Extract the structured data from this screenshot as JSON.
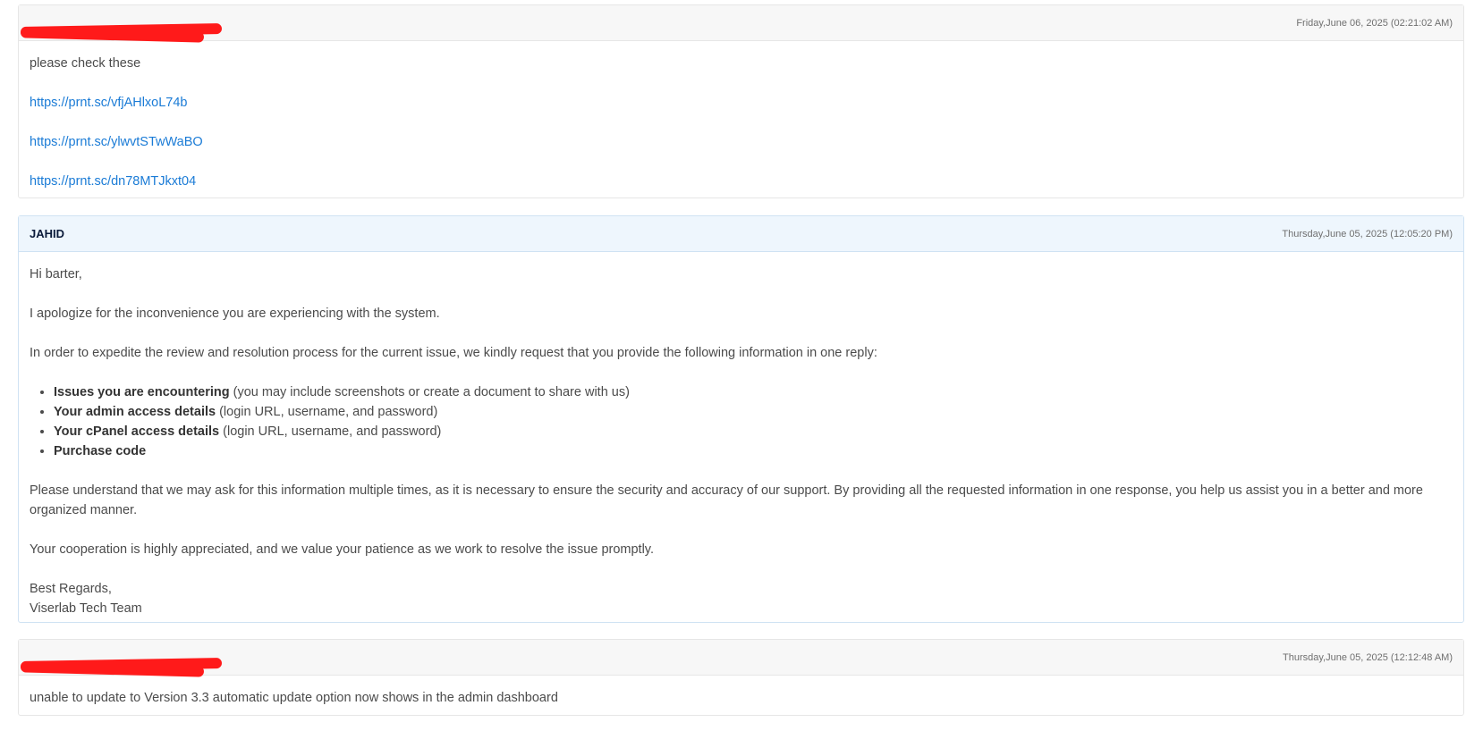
{
  "messages": [
    {
      "author": "",
      "email": "",
      "timestamp": "Friday,June 06, 2025 (02:21:02 AM)",
      "body_intro": "please check these",
      "links": [
        "https://prnt.sc/vfjAHlxoL74b",
        "https://prnt.sc/ylwvtSTwWaBO",
        "https://prnt.sc/dn78MTJkxt04"
      ]
    },
    {
      "author": "JAHID",
      "timestamp": "Thursday,June 05, 2025 (12:05:20 PM)",
      "greeting": "Hi barter,",
      "apology": "I apologize for the inconvenience you are experiencing with the system.",
      "request": "In order to expedite the review and resolution process for the current issue, we kindly request that you provide the following information in one reply:",
      "items": [
        {
          "bold": "Issues you are encountering",
          "rest": " (you may include screenshots or create a document to share with us)"
        },
        {
          "bold": "Your admin access details",
          "rest": " (login URL, username, and password)"
        },
        {
          "bold": "Your cPanel access details",
          "rest": " (login URL, username, and password)"
        },
        {
          "bold": "Purchase code",
          "rest": ""
        }
      ],
      "understand": "Please understand that we may ask for this information multiple times, as it is necessary to ensure the security and accuracy of our support. By providing all the requested information in one response, you help us assist you in a better and more organized manner.",
      "cooperation": "Your cooperation is highly appreciated, and we value your patience as we work to resolve the issue promptly.",
      "signoff_1": "Best Regards,",
      "signoff_2": "Viserlab Tech Team"
    },
    {
      "author": "",
      "email": "",
      "timestamp": "Thursday,June 05, 2025 (12:12:48 AM)",
      "body": "unable to update to Version 3.3 automatic update option now shows in the admin dashboard"
    }
  ],
  "colors": {
    "link": "#1a7bd6",
    "staff_header_bg": "#eef6fd",
    "redaction": "#ff1a1a"
  }
}
